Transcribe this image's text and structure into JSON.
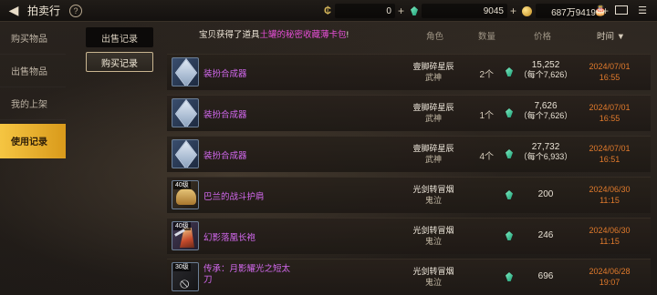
{
  "header": {
    "title": "拍卖行",
    "currency_c": "0",
    "currency_gem": "9045",
    "currency_gold": "687万9419"
  },
  "sidebar": {
    "items": [
      {
        "label": "购买物品",
        "active": false
      },
      {
        "label": "出售物品",
        "active": false
      },
      {
        "label": "我的上架",
        "active": false
      },
      {
        "label": "使用记录",
        "active": true
      }
    ]
  },
  "subtabs": {
    "sell": "出售记录",
    "buy": "购买记录"
  },
  "notice": {
    "prefix": "宝贝获得了道具",
    "highlight": "土罐的秘密收藏薄卡包",
    "suffix": "!"
  },
  "columns": {
    "role": "角色",
    "qty": "数量",
    "price": "价格",
    "time": "时间 ▼"
  },
  "rows": [
    {
      "icon": "cube",
      "level": "",
      "name": "装扮合成器",
      "role": "壹脚碎星辰",
      "cls": "武神",
      "qty": "2个",
      "price": "15,252",
      "each": "（每个7,626）",
      "date": "2024/07/01",
      "time": "16:55"
    },
    {
      "icon": "cube",
      "level": "",
      "name": "装扮合成器",
      "role": "壹脚碎星辰",
      "cls": "武神",
      "qty": "1个",
      "price": "7,626",
      "each": "（每个7,626）",
      "date": "2024/07/01",
      "time": "16:55"
    },
    {
      "icon": "cube",
      "level": "",
      "name": "装扮合成器",
      "role": "壹脚碎星辰",
      "cls": "武神",
      "qty": "4个",
      "price": "27,732",
      "each": "（每个6,933）",
      "date": "2024/07/01",
      "time": "16:51"
    },
    {
      "icon": "shoulder",
      "level": "40级",
      "name": "巴兰的战斗护肩",
      "role": "光剑转冒烟",
      "cls": "鬼泣",
      "qty": "",
      "price": "200",
      "each": "",
      "date": "2024/06/30",
      "time": "11:15"
    },
    {
      "icon": "cloak",
      "level": "40级",
      "name": "幻影落凰长袍",
      "role": "光剑转冒烟",
      "cls": "鬼泣",
      "qty": "",
      "price": "246",
      "each": "",
      "date": "2024/06/30",
      "time": "11:15"
    },
    {
      "icon": "weapon",
      "level": "30级",
      "name": "传承：月影耀光之短太刀",
      "role": "光剑转冒烟",
      "cls": "鬼泣",
      "qty": "",
      "price": "696",
      "each": "",
      "date": "2024/06/28",
      "time": "19:07"
    }
  ],
  "colors": {
    "accent_gold": "#f5c542",
    "item_purple": "#d469f0",
    "time_orange": "#e07a2c"
  }
}
